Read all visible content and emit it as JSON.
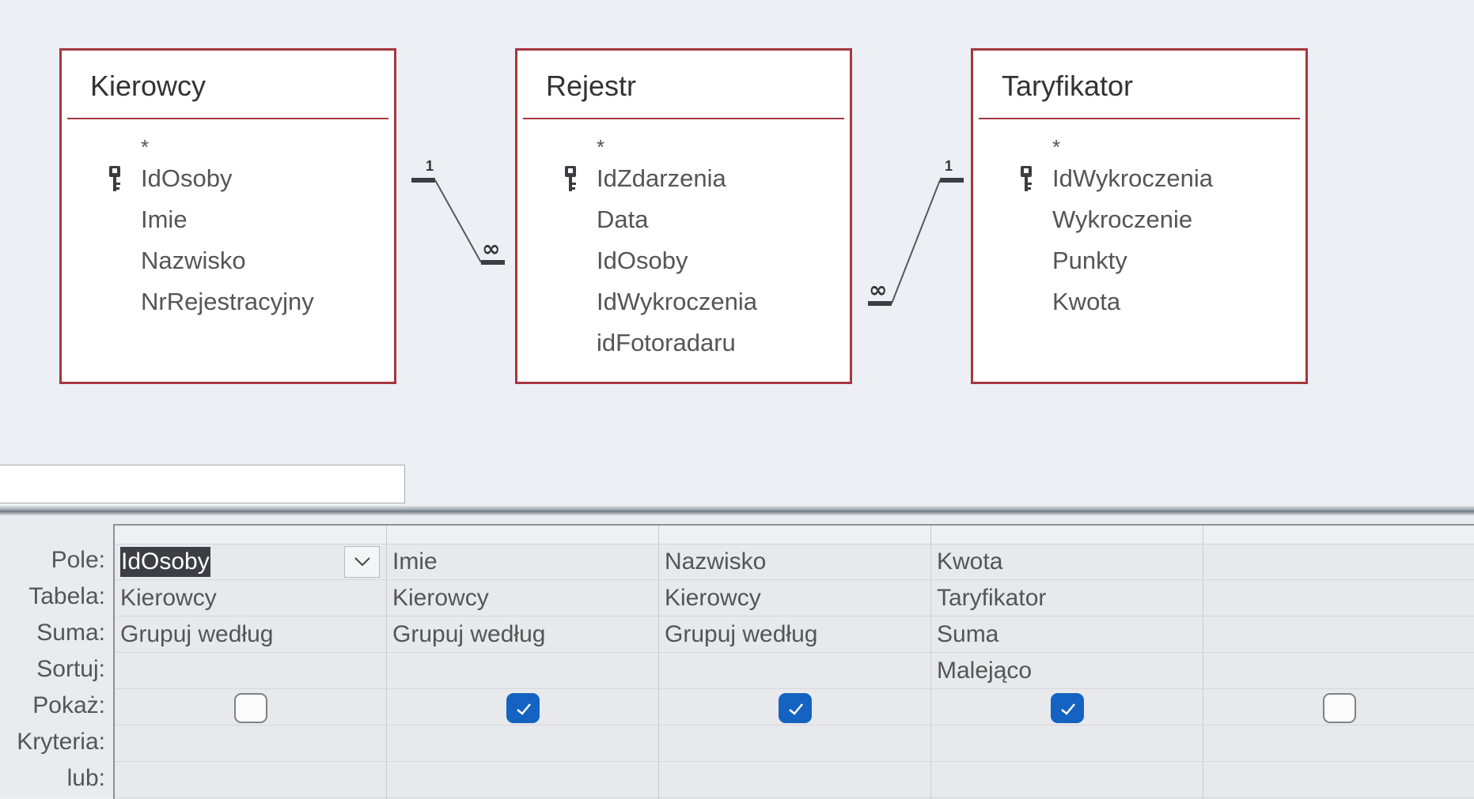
{
  "tables": [
    {
      "title": "Kierowcy",
      "fields": [
        {
          "name": "*",
          "star": true
        },
        {
          "name": "IdOsoby",
          "key": true
        },
        {
          "name": "Imie"
        },
        {
          "name": "Nazwisko"
        },
        {
          "name": "NrRejestracyjny"
        }
      ]
    },
    {
      "title": "Rejestr",
      "fields": [
        {
          "name": "*",
          "star": true
        },
        {
          "name": "IdZdarzenia",
          "key": true
        },
        {
          "name": "Data"
        },
        {
          "name": "IdOsoby"
        },
        {
          "name": "IdWykroczenia"
        },
        {
          "name": "idFotoradaru"
        }
      ]
    },
    {
      "title": "Taryfikator",
      "fields": [
        {
          "name": "*",
          "star": true
        },
        {
          "name": "IdWykroczenia",
          "key": true
        },
        {
          "name": "Wykroczenie"
        },
        {
          "name": "Punkty"
        },
        {
          "name": "Kwota"
        }
      ]
    }
  ],
  "relationships": [
    {
      "one_label": "1",
      "many_label": "∞"
    },
    {
      "one_label": "1",
      "many_label": "∞"
    }
  ],
  "row_labels": [
    "Pole:",
    "Tabela:",
    "Suma:",
    "Sortuj:",
    "Pokaż:",
    "Kryteria:",
    "lub:"
  ],
  "columns": [
    {
      "pole": "IdOsoby",
      "tabela": "Kierowcy",
      "suma": "Grupuj według",
      "sortuj": "",
      "pokaz": false,
      "active": true
    },
    {
      "pole": "Imie",
      "tabela": "Kierowcy",
      "suma": "Grupuj według",
      "sortuj": "",
      "pokaz": true
    },
    {
      "pole": "Nazwisko",
      "tabela": "Kierowcy",
      "suma": "Grupuj według",
      "sortuj": "",
      "pokaz": true
    },
    {
      "pole": "Kwota",
      "tabela": "Taryfikator",
      "suma": "Suma",
      "sortuj": "Malejąco",
      "pokaz": true
    },
    {
      "pole": "",
      "tabela": "",
      "suma": "",
      "sortuj": "",
      "pokaz": false
    }
  ],
  "colors": {
    "table_border": "#a5373f",
    "checkbox_checked": "#1463c3"
  }
}
